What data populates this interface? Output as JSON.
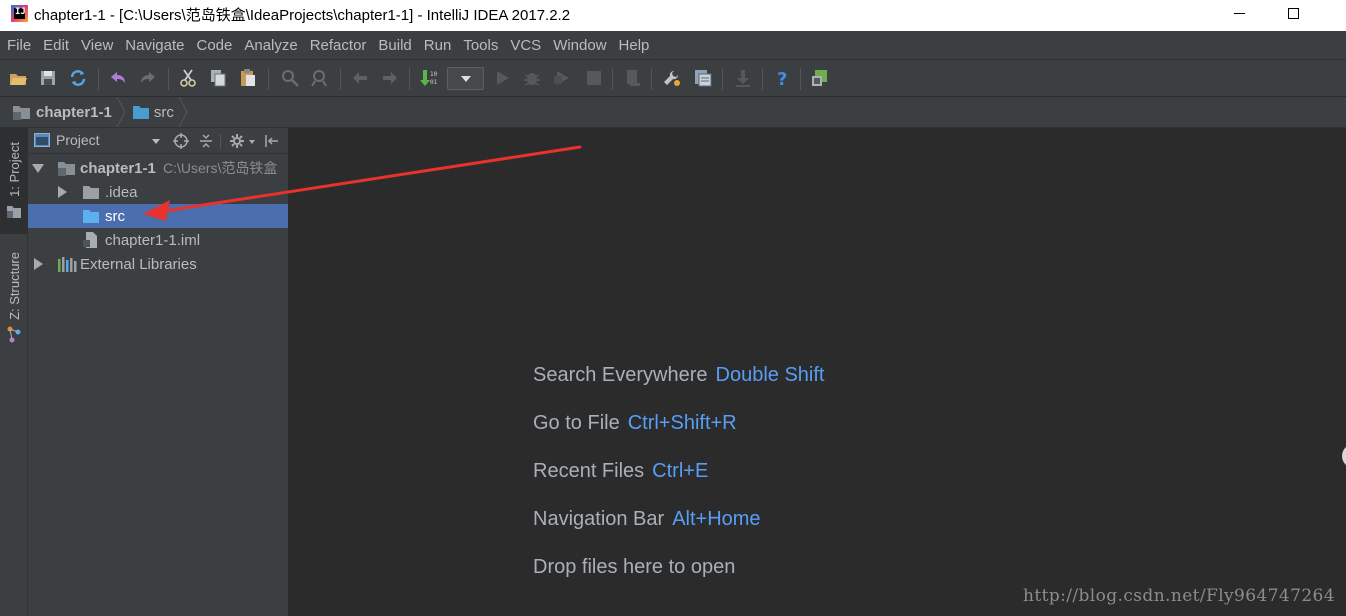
{
  "window": {
    "title": "chapter1-1 - [C:\\Users\\范岛铁盒\\IdeaProjects\\chapter1-1] - IntelliJ IDEA 2017.2.2",
    "app_icon_text": "IJ",
    "minimize_icon": "minimize-icon",
    "maximize_icon": "maximize-icon"
  },
  "menu": {
    "items": [
      "File",
      "Edit",
      "View",
      "Navigate",
      "Code",
      "Analyze",
      "Refactor",
      "Build",
      "Run",
      "Tools",
      "VCS",
      "Window",
      "Help"
    ]
  },
  "toolbar": {
    "icons": [
      "open-folder-icon",
      "save-icon",
      "sync-icon",
      "undo-icon",
      "redo-icon",
      "cut-icon",
      "copy-icon",
      "paste-icon",
      "find-icon",
      "replace-icon",
      "back-icon",
      "forward-icon",
      "build-icon",
      "run-config-dropdown",
      "run-icon",
      "debug-icon",
      "coverage-icon",
      "stop-icon",
      "vcs-icon",
      "settings-icon",
      "project-structure-icon",
      "sdk-icon",
      "help-icon",
      "plugin-icon"
    ]
  },
  "navbar": {
    "crumbs": [
      {
        "label": "chapter1-1",
        "icon": "module-folder-icon"
      },
      {
        "label": "src",
        "icon": "source-folder-icon"
      }
    ]
  },
  "left_strip": {
    "tabs": [
      {
        "label": "1: Project",
        "icon": "project-icon",
        "active": true
      },
      {
        "label": "Z: Structure",
        "icon": "structure-icon",
        "active": false
      }
    ]
  },
  "project_panel": {
    "view_label": "Project",
    "header_icons": [
      "locate-icon",
      "collapse-icon",
      "gear-icon",
      "hide-icon"
    ],
    "tree": [
      {
        "label": "chapter1-1",
        "path": "C:\\Users\\范岛铁盒",
        "expanded": true,
        "icon": "module-folder-icon"
      },
      {
        "label": ".idea",
        "expanded": false,
        "icon": "folder-icon"
      },
      {
        "label": "src",
        "selected": true,
        "icon": "source-folder-icon"
      },
      {
        "label": "chapter1-1.iml",
        "icon": "iml-file-icon"
      },
      {
        "label": "External Libraries",
        "expanded": false,
        "icon": "libraries-icon"
      }
    ]
  },
  "editor": {
    "hints": [
      {
        "action": "Search Everywhere",
        "shortcut": "Double Shift"
      },
      {
        "action": "Go to File",
        "shortcut": "Ctrl+Shift+R"
      },
      {
        "action": "Recent Files",
        "shortcut": "Ctrl+E"
      },
      {
        "action": "Navigation Bar",
        "shortcut": "Alt+Home"
      },
      {
        "action": "Drop files here to open",
        "shortcut": ""
      }
    ],
    "watermark": "http://blog.csdn.net/Fly964747264"
  },
  "colors": {
    "accent": "#589df6",
    "selection": "#4b6eaf",
    "annotation": "#e8322d",
    "background": "#2b2b2b",
    "panel": "#3c3f41"
  }
}
